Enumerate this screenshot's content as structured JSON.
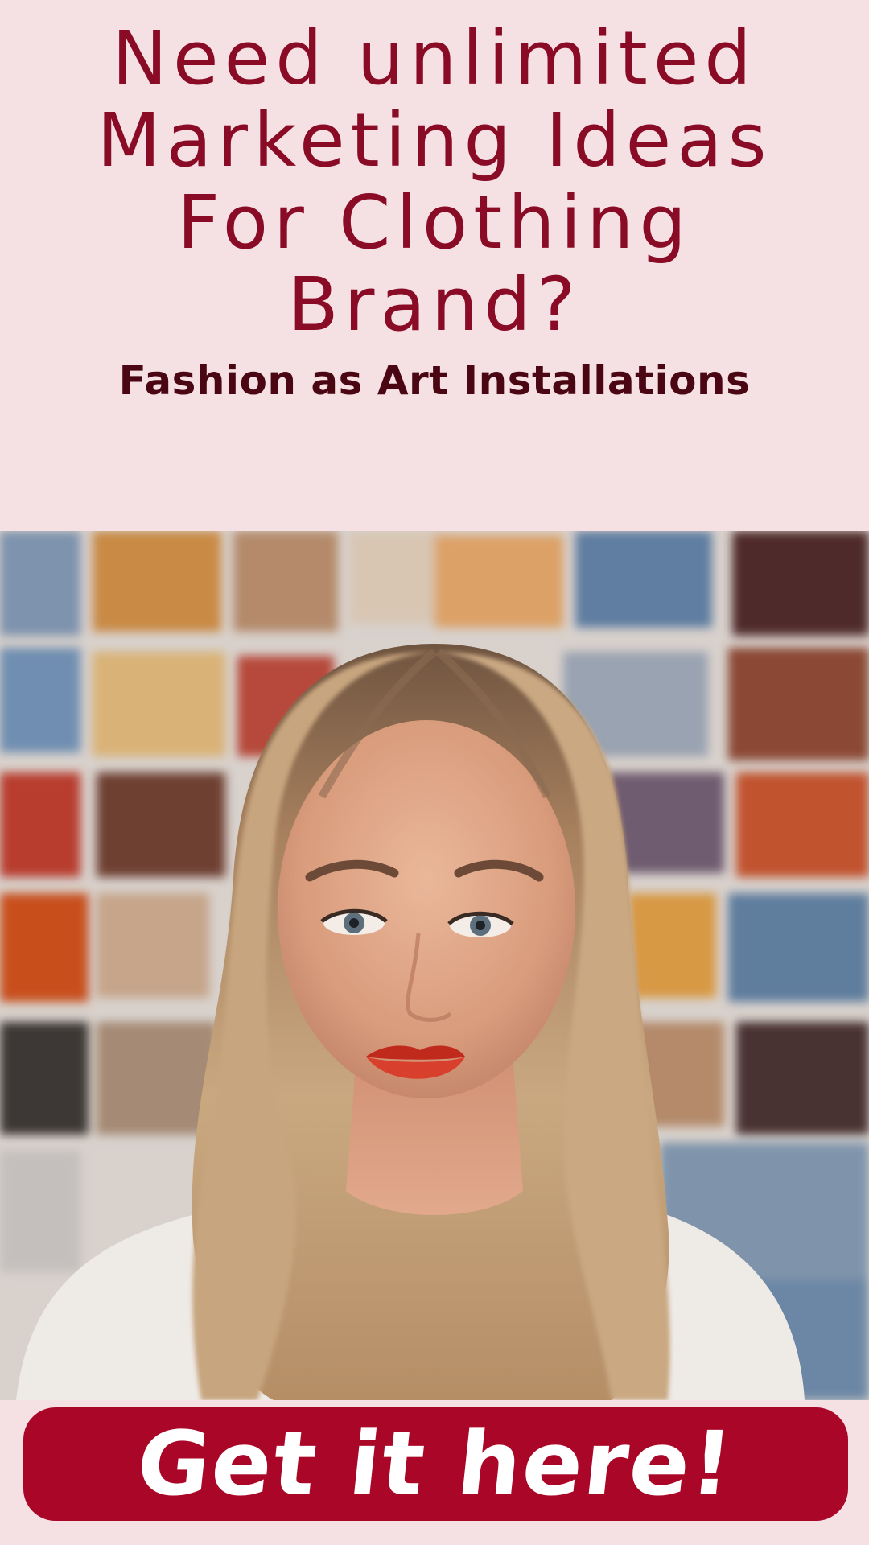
{
  "headline": {
    "lines": [
      "Need unlimited",
      "Marketing Ideas",
      "For Clothing",
      "Brand?"
    ]
  },
  "subheadline": "Fashion as Art Installations",
  "cta": {
    "label": "Get it here!"
  },
  "colors": {
    "background": "#f5e0e4",
    "headline": "#8a0b25",
    "subheadline": "#4a0612",
    "cta_background": "#aa0627",
    "cta_text": "#ffffff"
  }
}
